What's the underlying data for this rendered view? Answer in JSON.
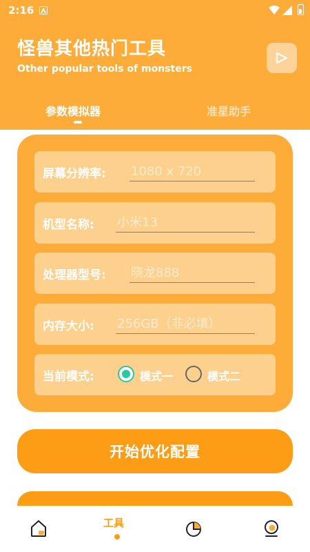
{
  "status_bar": {
    "time": "2:16"
  },
  "header": {
    "title": "怪兽其他热门工具",
    "subtitle": "Other popular tools of monsters",
    "tabs": [
      {
        "label": "参数模拟器",
        "active": true
      },
      {
        "label": "准星助手",
        "active": false
      }
    ]
  },
  "form": {
    "resolution": {
      "label": "屏幕分辨率:",
      "placeholder": "1080 x 720",
      "value": ""
    },
    "model": {
      "label": "机型名称:",
      "placeholder": "小米13",
      "value": ""
    },
    "processor": {
      "label": "处理器型号:",
      "placeholder": "晓龙888",
      "value": ""
    },
    "memory": {
      "label": "内存大小:",
      "placeholder": "256GB（非必填）",
      "value": ""
    },
    "mode": {
      "label": "当前模式:",
      "options": [
        {
          "label": "模式一",
          "selected": true
        },
        {
          "label": "模式二",
          "selected": false
        }
      ]
    }
  },
  "actions": {
    "start_label": "开始优化配置"
  },
  "bottom_nav": {
    "items": [
      {
        "icon": "home-icon",
        "label": "",
        "active": false
      },
      {
        "icon": "tools-icon",
        "label": "工具",
        "active": true
      },
      {
        "icon": "pie-chart-icon",
        "label": "",
        "active": false
      },
      {
        "icon": "profile-icon",
        "label": "",
        "active": false
      }
    ]
  },
  "colors": {
    "primary": "#FDAC3A",
    "button": "#FD9C15",
    "field_bg": "#FED08E",
    "radio_active": "#26C9A3"
  }
}
